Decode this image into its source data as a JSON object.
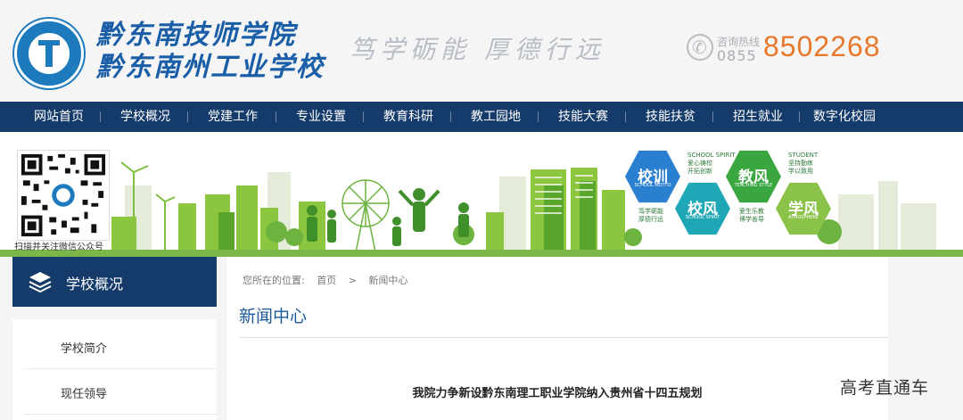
{
  "header": {
    "school_name_line1": "黔东南技师学院",
    "school_name_line2": "黔东南州工业学校",
    "motto": "笃学砺能  厚德行远",
    "hotline_label": "咨询热线",
    "hotline_area": "0855",
    "hotline_number": "8502268"
  },
  "nav": {
    "items": [
      "网站首页",
      "学校概况",
      "党建工作",
      "专业设置",
      "教育科研",
      "教工园地",
      "技能大赛",
      "技能扶贫",
      "招生就业",
      "数字化校园"
    ]
  },
  "banner": {
    "qr_caption": "扫描并关注微信公众号",
    "hexes": [
      {
        "label": "校训",
        "sub": "SCHOOL MOTTO",
        "color": "#2a7fd0"
      },
      {
        "label": "校风",
        "sub": "SCHOOL SPIRIT",
        "color": "#1fa7b5"
      },
      {
        "label": "教风",
        "sub": "TEACHING STYLE",
        "color": "#3aa63f"
      },
      {
        "label": "学风",
        "sub": "ATMOSPHERE",
        "color": "#8bc34a"
      }
    ],
    "notes": [
      {
        "lines": [
          "笃学砺能",
          "厚德行远"
        ]
      },
      {
        "lines": [
          "SCHOOL SPIRIT",
          "爱心铸校",
          "开拓创新"
        ]
      },
      {
        "lines": [
          "爱生乐教",
          "博学善导"
        ]
      },
      {
        "lines": [
          "STUDENT",
          "坚持勤练",
          "学以致用"
        ]
      }
    ]
  },
  "sidebar": {
    "title": "学校概况",
    "items": [
      "学校简介",
      "现任领导"
    ]
  },
  "main": {
    "breadcrumb_label": "您所在的位置:",
    "breadcrumb_home": "首页",
    "breadcrumb_sep": ">",
    "breadcrumb_current": "新闻中心",
    "section_title": "新闻中心",
    "article_title": "我院力争新设黔东南理工职业学院纳入贵州省十四五规划"
  },
  "watermark": "高考直通车",
  "colors": {
    "nav_bg": "#153b6b",
    "hotline_number": "#e8792c",
    "school_name": "#1a5ea8",
    "section_title": "#1a5a9c"
  }
}
